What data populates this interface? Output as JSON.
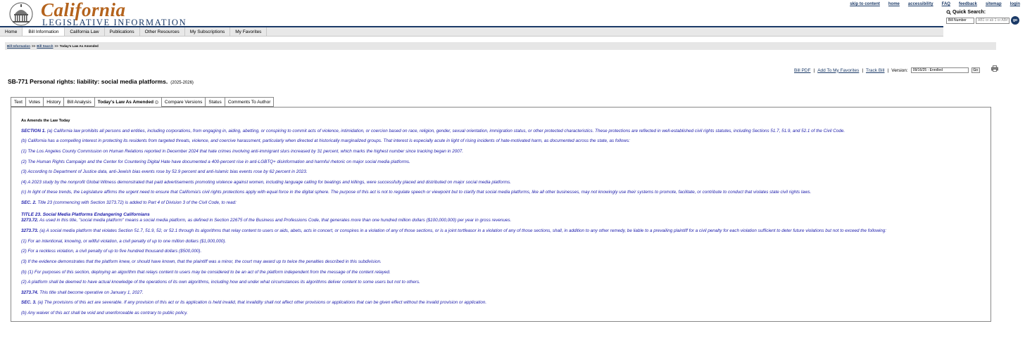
{
  "header": {
    "logo_word": "California",
    "logo_sub": "LEGISLATIVE INFORMATION",
    "top_links": [
      "skip to content",
      "home",
      "accessibility",
      "FAQ",
      "feedback",
      "sitemap",
      "login"
    ],
    "quick_search_label": "Quick Search:",
    "quick_search_select": "Bill Number",
    "quick_search_placeholder": "AB1 or ab 1 or AB#",
    "go_label": "go"
  },
  "nav": {
    "items": [
      "Home",
      "Bill Information",
      "California Law",
      "Publications",
      "Other Resources",
      "My Subscriptions",
      "My Favorites"
    ],
    "active_index": 1
  },
  "breadcrumb": {
    "items": [
      "Bill Information",
      "Bill Search",
      "Today's Law As Amended"
    ],
    "sep": ">>"
  },
  "bill": {
    "title": "SB-771 Personal rights: liability: social media platforms.",
    "session": "(2025-2026)"
  },
  "actions": {
    "bill_pdf": "Bill PDF",
    "add_favorites": "Add To My Favorites",
    "track_bill": "Track Bill",
    "version_label": "Version:",
    "version_value": "09/16/25 - Enrolled",
    "go_label": "Go",
    "sep": "|"
  },
  "tabs": {
    "items": [
      "Text",
      "Votes",
      "History",
      "Bill Analysis",
      "Today's Law As Amended",
      "Compare Versions",
      "Status",
      "Comments To Author"
    ],
    "active_index": 4
  },
  "content": {
    "heading": "As Amends the Law Today",
    "paragraphs": [
      {
        "lead": "SECTION 1.",
        "text": " (a) California law prohibits all persons and entities, including corporations, from engaging in, aiding, abetting, or conspiring to commit acts of violence, intimidation, or coercion based on race, religion, gender, sexual orientation, immigration status, or other protected characteristics. These protections are reflected in well-established civil rights statutes, including Sections 51.7, 51.9, and 52.1 of the Civil Code."
      },
      {
        "lead": "",
        "text": "(b) California has a compelling interest in protecting its residents from targeted threats, violence, and coercive harassment, particularly when directed at historically marginalized groups. That interest is especially acute in light of rising incidents of hate-motivated harm, as documented across the state, as follows:"
      },
      {
        "lead": "",
        "text": "(1) The Los Angeles County Commission on Human Relations reported in December 2024 that hate crimes involving anti-immigrant slurs increased by 31 percent, which marks the highest number since tracking began in 2007."
      },
      {
        "lead": "",
        "text": "(2) The Human Rights Campaign and the Center for Countering Digital Hate have documented a 400-percent rise in anti-LGBTQ+ disinformation and harmful rhetoric on major social media platforms."
      },
      {
        "lead": "",
        "text": "(3) According to Department of Justice data, anti-Jewish bias events rose by 52.9 percent and anti-Islamic bias events rose by 62 percent in 2023."
      },
      {
        "lead": "",
        "text": "(4) A 2023 study by the nonprofit Global Witness demonstrated that paid advertisements promoting violence against women, including language calling for beatings and killings, were successfully placed and distributed on major social media platforms."
      },
      {
        "lead": "",
        "text": "(c) In light of these trends, the Legislature affirms the urgent need to ensure that California's civil rights protections apply with equal force in the digital sphere. The purpose of this act is not to regulate speech or viewpoint but to clarify that social media platforms, like all other businesses, may not knowingly use their systems to promote, facilitate, or contribute to conduct that violates state civil rights laws."
      },
      {
        "lead": "SEC. 2.",
        "text": " Title 23 (commencing with Section 3273.72) is added to Part 4 of Division 3 of the Civil Code, to read:"
      },
      {
        "lead": "",
        "text": "TITLE 23. Social Media Platforms Endangering Californians"
      },
      {
        "lead": "3273.72.",
        "text": " As used in this title, \"social media platform\" means a social media platform, as defined in Section 22675 of the Business and Professions Code, that generates more than one hundred million dollars ($100,000,000) per year in gross revenues."
      },
      {
        "lead": "3273.73.",
        "text": " (a) A social media platform that violates Section 51.7, 51.9, 52, or 52.1 through its algorithms that relay content to users or aids, abets, acts in concert, or conspires in a violation of any of those sections, or is a joint tortfeasor in a violation of any of those sections, shall, in addition to any other remedy, be liable to a prevailing plaintiff for a civil penalty for each violation sufficient to deter future violations but not to exceed the following:"
      },
      {
        "lead": "",
        "text": "(1) For an intentional, knowing, or willful violation, a civil penalty of up to one million dollars ($1,000,000)."
      },
      {
        "lead": "",
        "text": "(2) For a reckless violation, a civil penalty of up to five hundred thousand dollars ($500,000)."
      },
      {
        "lead": "",
        "text": "(3) If the evidence demonstrates that the platform knew, or should have known, that the plaintiff was a minor, the court may award up to twice the penalties described in this subdivision."
      },
      {
        "lead": "",
        "text": "(b) (1) For purposes of this section, deploying an algorithm that relays content to users may be considered to be an act of the platform independent from the message of the content relayed."
      },
      {
        "lead": "",
        "text": "(2) A platform shall be deemed to have actual knowledge of the operations of its own algorithms, including how and under what circumstances its algorithms deliver content to some users but not to others."
      },
      {
        "lead": "3273.74.",
        "text": " This title shall become operative on January 1, 2027."
      },
      {
        "lead": "SEC. 3.",
        "text": " (a) The provisions of this act are severable. If any provision of this act or its application is held invalid, that invalidity shall not affect other provisions or applications that can be given effect without the invalid provision or application."
      },
      {
        "lead": "",
        "text": "(b) Any waiver of this act shall be void and unenforceable as contrary to public policy."
      }
    ]
  },
  "colors": {
    "brand_orange": "#b4631d",
    "brand_navy": "#1b3a67",
    "amended_text": "#1a1aaa"
  }
}
